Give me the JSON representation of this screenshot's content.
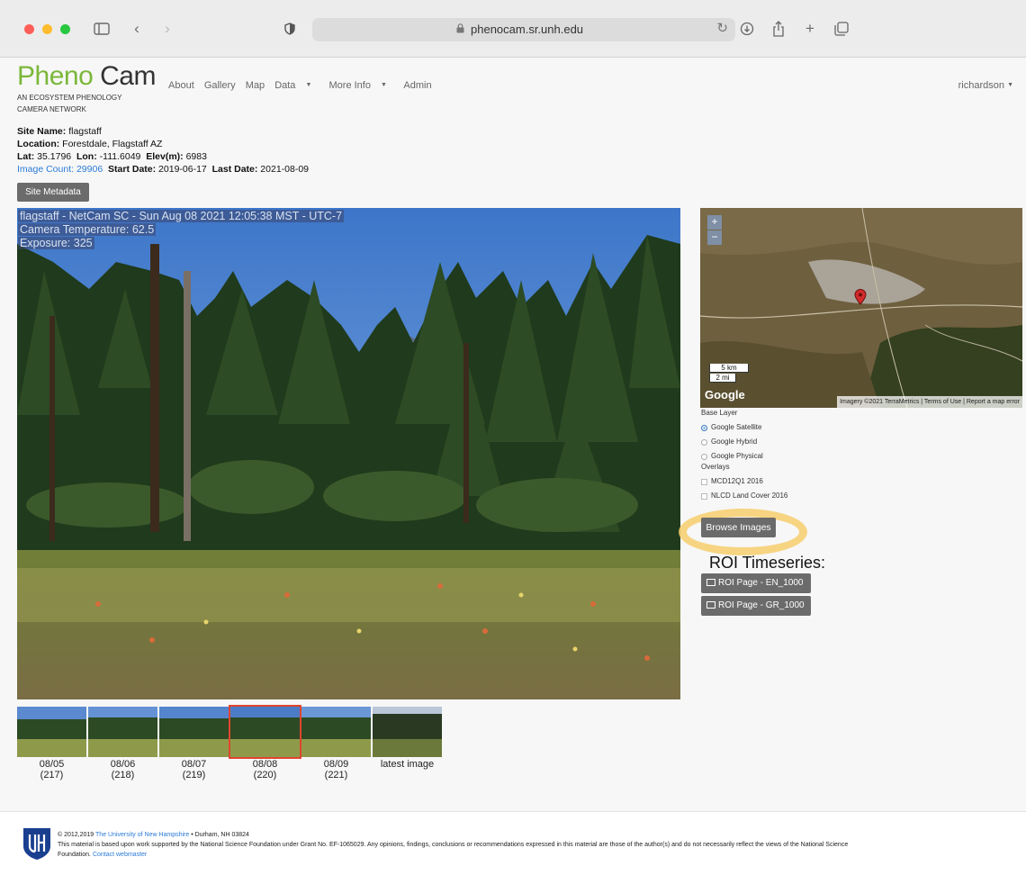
{
  "browser": {
    "url": "phenocam.sr.unh.edu"
  },
  "header": {
    "logo_part1": "Pheno",
    "logo_part2": "Cam",
    "logo_sub_line1": "AN ECOSYSTEM PHENOLOGY",
    "logo_sub_line2": "CAMERA NETWORK",
    "nav": [
      "About",
      "Gallery",
      "Map",
      "Data",
      "More Info",
      "Admin"
    ],
    "user": "richardson"
  },
  "site": {
    "name_label": "Site Name:",
    "name": "flagstaff",
    "location_label": "Location:",
    "location": "Forestdale, Flagstaff AZ",
    "lat_label": "Lat:",
    "lat": "35.1796",
    "lon_label": "Lon:",
    "lon": "-111.6049",
    "elev_label": "Elev(m):",
    "elev": "6983",
    "image_count_label": "Image Count:",
    "image_count": "29906",
    "start_label": "Start Date:",
    "start_date": "2019-06-17",
    "last_label": "Last Date:",
    "last_date": "2021-08-09",
    "metadata_button": "Site Metadata"
  },
  "photo": {
    "overlay_line1": "flagstaff  -  NetCam SC  -  Sun Aug 08 2021  12:05:38 MST - UTC-7",
    "overlay_line2": "Camera Temperature: 62.5",
    "overlay_line3": "Exposure: 325"
  },
  "map": {
    "zoom_in": "+",
    "zoom_out": "−",
    "scale_km": "5 km",
    "scale_mi": "2 mi",
    "google": "Google",
    "attribution": "Imagery ©2021 TerraMetrics  |  Terms of Use  |  Report a map error",
    "base_layer_label": "Base Layer",
    "base_layers": [
      "Google Satellite",
      "Google Hybrid",
      "Google Physical"
    ],
    "overlays_label": "Overlays",
    "overlays": [
      "MCD12Q1 2016",
      "NLCD Land Cover 2016"
    ]
  },
  "actions": {
    "browse_button": "Browse Images",
    "roi_title": "ROI Timeseries:",
    "roi_buttons": [
      "ROI Page - EN_1000",
      "ROI Page - GR_1000"
    ]
  },
  "thumbnails": [
    {
      "date": "08/05",
      "count": "(217)"
    },
    {
      "date": "08/06",
      "count": "(218)"
    },
    {
      "date": "08/07",
      "count": "(219)"
    },
    {
      "date": "08/08",
      "count": "(220)"
    },
    {
      "date": "08/09",
      "count": "(221)"
    },
    {
      "date": "latest image",
      "count": ""
    }
  ],
  "footer": {
    "copyright": "© 2012,2019",
    "university": "The University of New Hampshire",
    "address": " •  Durham, NH 03824",
    "line2": "This material is based upon work supported by the National Science Foundation under Grant No. EF-1065029. Any opinions, findings, conclusions or recommendations expressed in this material are those of the author(s) and do not necessarily reflect the views of the National Science",
    "line3": "Foundation.",
    "contact": "Contact webmaster"
  }
}
